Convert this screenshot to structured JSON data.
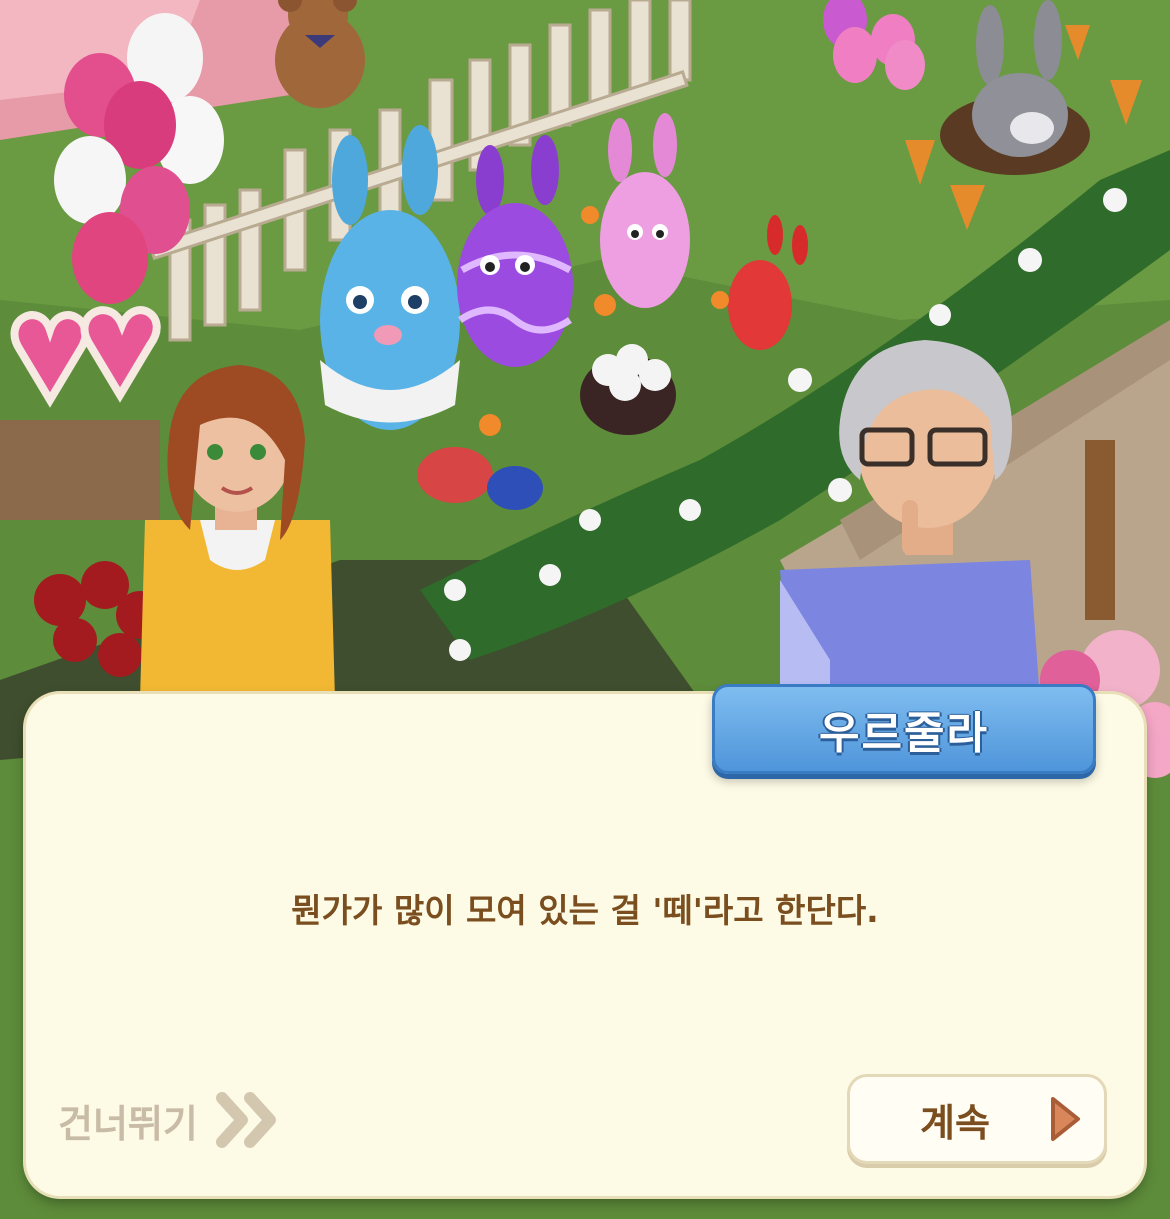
{
  "dialog": {
    "speaker": "우르줄라",
    "message": "뭔가가 많이 모여 있는 걸 '떼'라고 한단다.",
    "skip_label": "건너뛰기",
    "continue_label": "계속"
  },
  "colors": {
    "panel": "#fdfbe6",
    "name_tag": "#5ea3e4",
    "text_brown": "#7a4e1e",
    "skip_gray": "#c9bca6",
    "grass": "#5f8f3a"
  },
  "icons": {
    "skip": "double-chevron-right-icon",
    "continue": "play-triangle-icon"
  }
}
